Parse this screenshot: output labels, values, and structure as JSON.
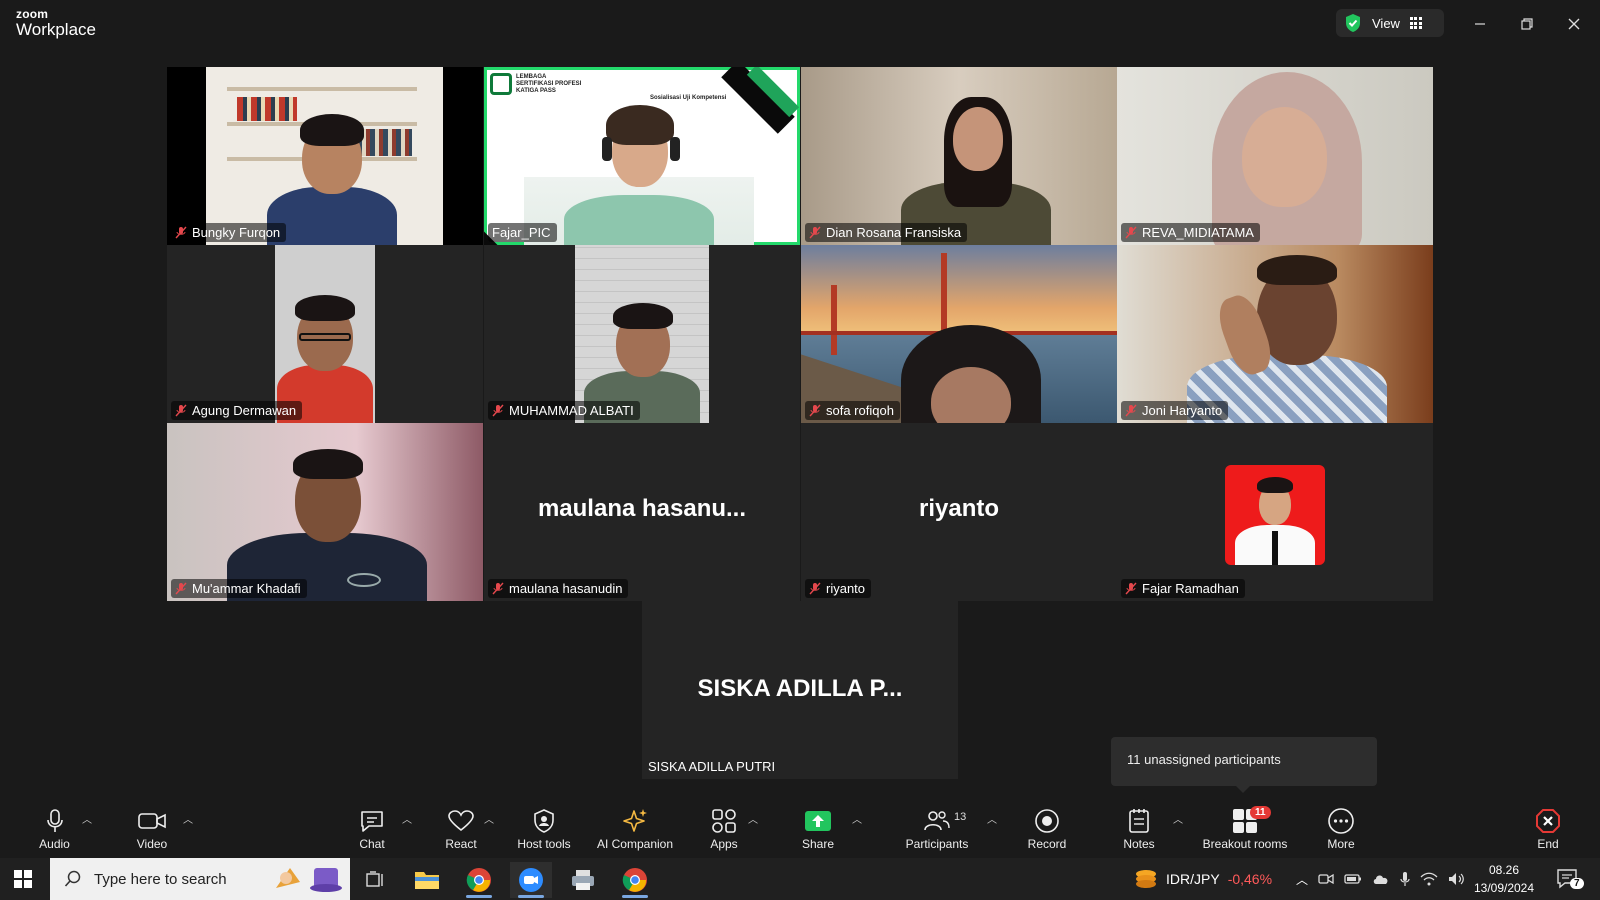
{
  "app": {
    "brand_small": "zoom",
    "brand_large": "Workplace",
    "view_label": "View"
  },
  "colors": {
    "active_speaker": "#23d96b",
    "muted_icon": "#e5484d",
    "share_green": "#22c55e",
    "end_red": "#e53935"
  },
  "participants": [
    {
      "name": "Bungky Furqon",
      "muted": true
    },
    {
      "name": "Fajar_PIC",
      "muted": false,
      "active": true
    },
    {
      "name": "Dian Rosana Fransiska",
      "muted": true
    },
    {
      "name": "REVA_MIDIATAMA",
      "muted": true
    },
    {
      "name": "Agung Dermawan",
      "muted": true
    },
    {
      "name": "MUHAMMAD ALBATI",
      "muted": true
    },
    {
      "name": "sofa rofiqoh",
      "muted": true
    },
    {
      "name": "Joni Haryanto",
      "muted": true
    },
    {
      "name": "Mu'ammar Khadafi",
      "muted": true
    },
    {
      "name": "maulana hasanudin",
      "muted": true,
      "display": "maulana  hasanu..."
    },
    {
      "name": "riyanto",
      "muted": true,
      "display": "riyanto"
    },
    {
      "name": "Fajar Ramadhan",
      "muted": true
    },
    {
      "name": "SISKA ADILLA PUTRI",
      "muted": false,
      "display": "SISKA  ADILLA  P..."
    }
  ],
  "slide": {
    "org_line1": "LEMBAGA",
    "org_line2": "SERTIFIKASI PROFESI",
    "org_line3": "KATIGA PASS",
    "title": "Sosialisasi Uji Kompetensi"
  },
  "tooltip": "11 unassigned participants",
  "toolbar": {
    "audio": "Audio",
    "video": "Video",
    "chat": "Chat",
    "react": "React",
    "host_tools": "Host tools",
    "ai_companion": "AI Companion",
    "apps": "Apps",
    "share": "Share",
    "participants": "Participants",
    "participants_count": "13",
    "record": "Record",
    "notes": "Notes",
    "breakout_rooms": "Breakout rooms",
    "breakout_badge": "11",
    "more": "More",
    "end": "End"
  },
  "taskbar": {
    "search_placeholder": "Type here to search",
    "ticker_pair": "IDR/JPY",
    "ticker_change": "-0,46%",
    "time": "08.26",
    "date": "13/09/2024",
    "notif_count": "7"
  }
}
